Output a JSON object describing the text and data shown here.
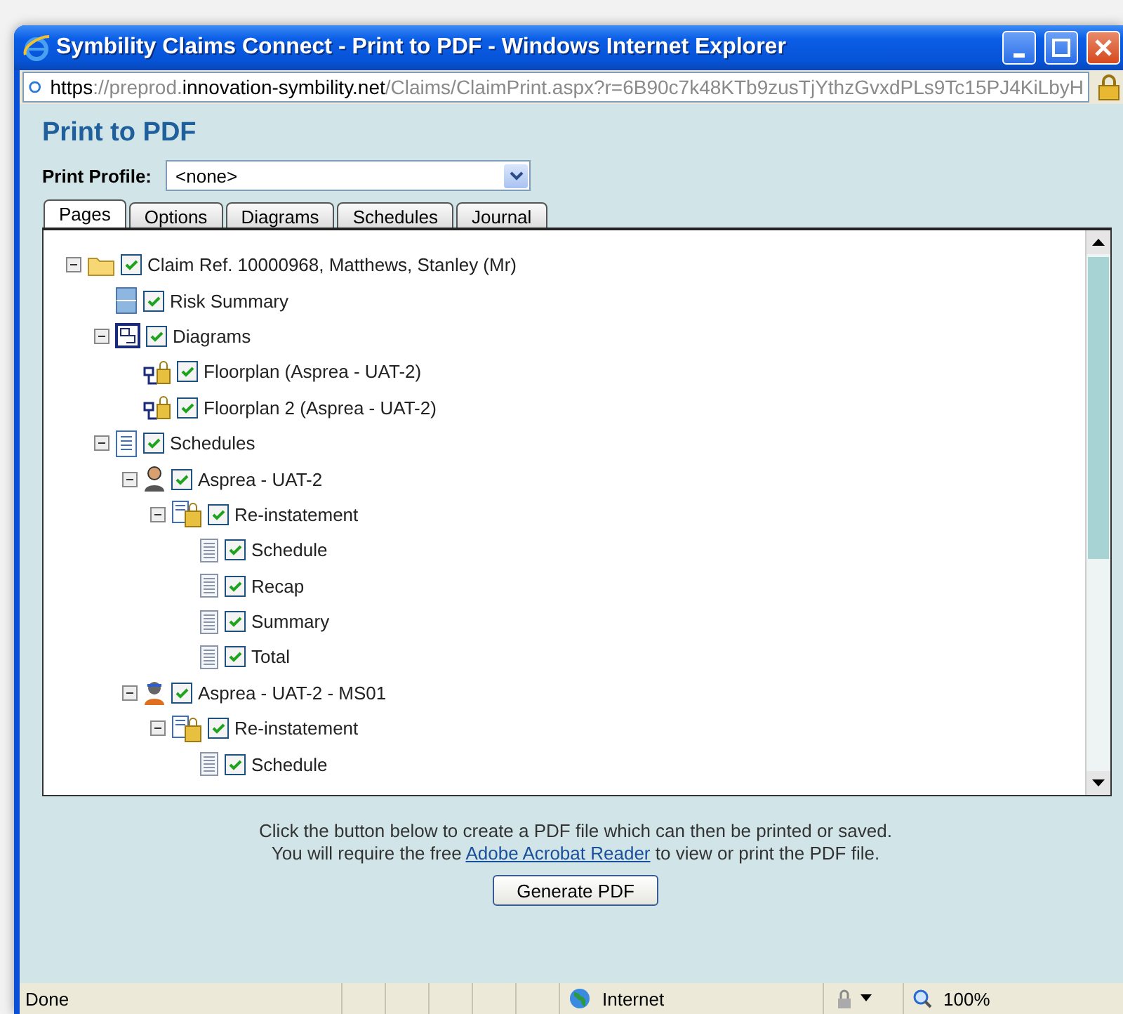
{
  "window": {
    "title": "Symbility Claims Connect - Print to PDF - Windows Internet Explorer"
  },
  "address": {
    "parts": [
      {
        "text": "https",
        "dim": false
      },
      {
        "text": "://preprod.",
        "dim": true
      },
      {
        "text": "innovation-symbility.net",
        "dim": false
      },
      {
        "text": "/Claims/ClaimPrint.aspx?r=6B90c7k48KTb9zusTjYthzGvxdPLs9Tc15PJ4KiLbyH",
        "dim": true
      }
    ]
  },
  "page": {
    "heading": "Print to PDF",
    "profile_label": "Print Profile:",
    "profile_value": "<none>"
  },
  "tabs": [
    {
      "label": "Pages",
      "selected": true
    },
    {
      "label": "Options",
      "selected": false
    },
    {
      "label": "Diagrams",
      "selected": false
    },
    {
      "label": "Schedules",
      "selected": false
    },
    {
      "label": "Journal",
      "selected": false
    }
  ],
  "tree": [
    {
      "label": "Claim Ref. 10000968, Matthews, Stanley (Mr)",
      "kind": "folder",
      "checked": true,
      "expanded": true,
      "children": [
        {
          "label": "Risk Summary",
          "kind": "risk",
          "checked": true
        },
        {
          "label": "Diagrams",
          "kind": "diagrams",
          "checked": true,
          "expanded": true,
          "children": [
            {
              "label": "Floorplan (Asprea - UAT-2)",
              "kind": "floorplan",
              "checked": true
            },
            {
              "label": "Floorplan 2 (Asprea - UAT-2)",
              "kind": "floorplan",
              "checked": true
            }
          ]
        },
        {
          "label": "Schedules",
          "kind": "schedules",
          "checked": true,
          "expanded": true,
          "children": [
            {
              "label": "Asprea - UAT-2",
              "kind": "person",
              "checked": true,
              "expanded": true,
              "children": [
                {
                  "label": "Re-instatement",
                  "kind": "reinstatement",
                  "checked": true,
                  "expanded": true,
                  "children": [
                    {
                      "label": "Schedule",
                      "kind": "page",
                      "checked": true
                    },
                    {
                      "label": "Recap",
                      "kind": "page",
                      "checked": true
                    },
                    {
                      "label": "Summary",
                      "kind": "page",
                      "checked": true
                    },
                    {
                      "label": "Total",
                      "kind": "page",
                      "checked": true
                    }
                  ]
                }
              ]
            },
            {
              "label": "Asprea - UAT-2 - MS01",
              "kind": "worker",
              "checked": true,
              "expanded": true,
              "children": [
                {
                  "label": "Re-instatement",
                  "kind": "reinstatement",
                  "checked": true,
                  "expanded": true,
                  "children": [
                    {
                      "label": "Schedule",
                      "kind": "page",
                      "checked": true
                    }
                  ]
                }
              ]
            }
          ]
        }
      ]
    }
  ],
  "footer": {
    "line1": "Click the button below to create a PDF file which can then be printed or saved.",
    "line2_before": "You will require the free",
    "link": "Adobe Acrobat Reader",
    "line2_after": "to view or print the PDF file.",
    "button": "Generate PDF"
  },
  "status_bar": {
    "status": "Done",
    "zone": "Internet",
    "zoom": "100%"
  }
}
